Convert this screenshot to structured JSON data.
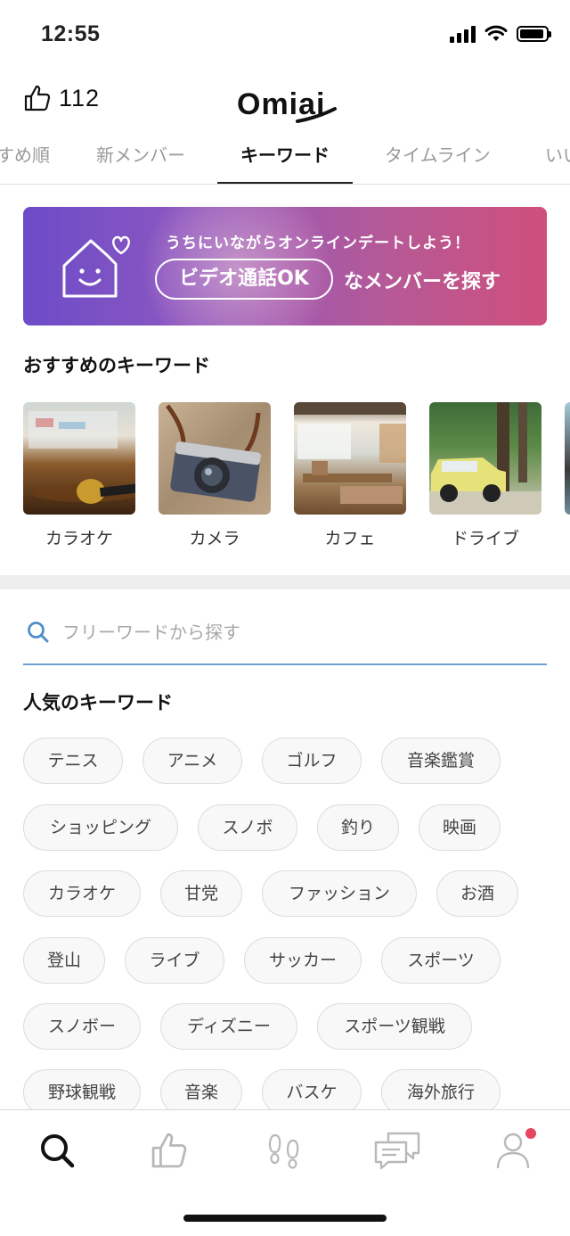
{
  "status": {
    "time": "12:55"
  },
  "header": {
    "likes_count": "112",
    "logo_text": "Omiai"
  },
  "tabs": [
    {
      "label": "すめ順"
    },
    {
      "label": "新メンバー"
    },
    {
      "label": "キーワード",
      "active": true
    },
    {
      "label": "タイムライン"
    },
    {
      "label": "いい"
    }
  ],
  "banner": {
    "line1": "うちにいながらオンラインデートしよう！",
    "pill": "ビデオ通話OK",
    "line2": "なメンバーを探す"
  },
  "recommended": {
    "title": "おすすめのキーワード",
    "items": [
      {
        "label": "カラオケ"
      },
      {
        "label": "カメラ"
      },
      {
        "label": "カフェ"
      },
      {
        "label": "ドライブ"
      }
    ]
  },
  "search": {
    "placeholder": "フリーワードから探す"
  },
  "popular": {
    "title": "人気のキーワード",
    "chips": [
      "テニス",
      "アニメ",
      "ゴルフ",
      "音楽鑑賞",
      "ショッピング",
      "スノボ",
      "釣り",
      "映画",
      "カラオケ",
      "甘党",
      "ファッション",
      "お酒",
      "登山",
      "ライブ",
      "サッカー",
      "スポーツ",
      "スノボー",
      "ディズニー",
      "スポーツ観戦",
      "野球観戦",
      "音楽",
      "バスケ",
      "海外旅行"
    ]
  },
  "colors": {
    "accent": "#6f9fd0",
    "badge": "#e8455f",
    "banner_start": "#6c4cc8",
    "banner_end": "#cf4f7c"
  },
  "bottom_nav": [
    {
      "icon": "search-icon",
      "active": true
    },
    {
      "icon": "thumbs-up-icon"
    },
    {
      "icon": "footprints-icon"
    },
    {
      "icon": "messages-icon"
    },
    {
      "icon": "profile-icon",
      "badge": true
    }
  ]
}
